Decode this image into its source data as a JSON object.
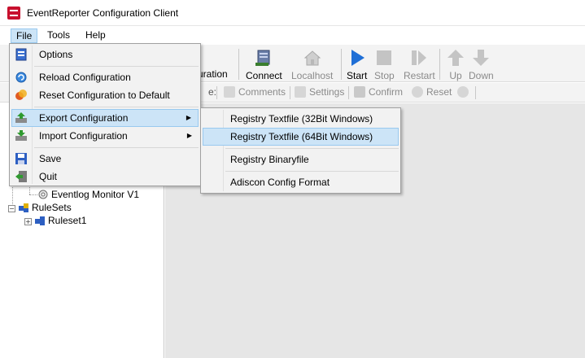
{
  "window": {
    "title": "EventReporter Configuration Client"
  },
  "menubar": {
    "file": "File",
    "tools": "Tools",
    "help": "Help"
  },
  "toolbar": {
    "partial_label": "uration",
    "connect": "Connect",
    "localhost": "Localhost",
    "start": "Start",
    "stop": "Stop",
    "restart": "Restart",
    "up": "Up",
    "down": "Down"
  },
  "toolbar2": {
    "partial": "e:",
    "comments": "Comments",
    "settings": "Settings",
    "confirm": "Confirm",
    "reset": "Reset"
  },
  "tree": {
    "eventlog_monitor": "Eventlog Monitor V1",
    "rulesets": "RuleSets",
    "ruleset1": "Ruleset1"
  },
  "file_menu": {
    "items": [
      {
        "label": "Options",
        "icon": "options-icon"
      },
      {
        "label": "Reload Configuration",
        "icon": "reload-icon"
      },
      {
        "label": "Reset Configuration to Default",
        "icon": "reset-default-icon"
      },
      {
        "label": "Export Configuration",
        "icon": "export-icon"
      },
      {
        "label": "Import Configuration",
        "icon": "import-icon"
      },
      {
        "label": "Save",
        "icon": "save-icon"
      },
      {
        "label": "Quit",
        "icon": "quit-icon"
      }
    ]
  },
  "export_submenu": {
    "items": [
      {
        "label": "Registry Textfile (32Bit Windows)"
      },
      {
        "label": "Registry Textfile (64Bit Windows)"
      },
      {
        "label": "Registry Binaryfile"
      },
      {
        "label": "Adiscon Config Format"
      }
    ]
  },
  "colors": {
    "highlight": "#cce4f7",
    "highlight_border": "#99c9ef",
    "start_blue": "#1f6fd6",
    "brand_red": "#c8102e"
  }
}
